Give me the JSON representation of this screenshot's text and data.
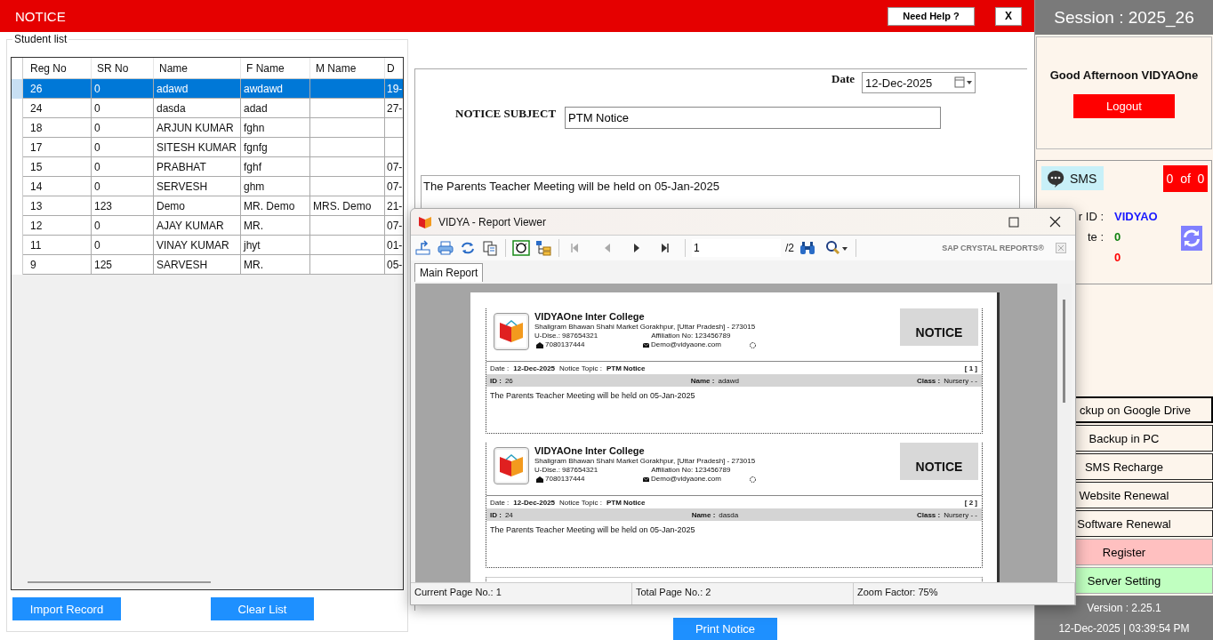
{
  "header": {
    "title": "NOTICE",
    "help_button": "Need Help ?",
    "close_button": "X"
  },
  "student_list": {
    "legend": "Student list",
    "columns": [
      "Reg No",
      "SR No",
      "Name",
      "F Name",
      "M Name",
      "D"
    ],
    "rows": [
      {
        "cells": [
          "26",
          "0",
          "adawd",
          "awdawd",
          null,
          "19-"
        ],
        "selected": true
      },
      {
        "cells": [
          "24",
          "0",
          "dasda",
          "adad",
          null,
          "27-"
        ],
        "selected": false
      },
      {
        "cells": [
          "18",
          "0",
          "ARJUN KUMAR",
          "fghn",
          null,
          null
        ],
        "selected": false
      },
      {
        "cells": [
          "17",
          "0",
          "SITESH KUMAR",
          "fgnfg",
          null,
          null
        ],
        "selected": false
      },
      {
        "cells": [
          "15",
          "0",
          "PRABHAT",
          "fghf",
          null,
          "07-"
        ],
        "selected": false
      },
      {
        "cells": [
          "14",
          "0",
          "SERVESH",
          "ghm",
          null,
          "07-"
        ],
        "selected": false
      },
      {
        "cells": [
          "13",
          "123",
          "Demo",
          "MR. Demo",
          "MRS. Demo",
          "21-"
        ],
        "selected": false
      },
      {
        "cells": [
          "12",
          "0",
          "AJAY KUMAR",
          "MR.",
          null,
          "07-"
        ],
        "selected": false
      },
      {
        "cells": [
          "11",
          "0",
          "VINAY KUMAR",
          "jhyt",
          null,
          "01-"
        ],
        "selected": false
      },
      {
        "cells": [
          "9",
          "125",
          "SARVESH",
          "MR.",
          null,
          "05-"
        ],
        "selected": false
      }
    ],
    "buttons": [
      "Import Record",
      "Clear List"
    ]
  },
  "notice_form": {
    "date_label": "Date",
    "date_value": "12-Dec-2025",
    "subject_label": "NOTICE SUBJECT",
    "subject_value": "PTM Notice",
    "message": "The Parents Teacher Meeting will be held on 05-Jan-2025",
    "print_button": "Print Notice"
  },
  "sidebar": {
    "session": "Session : 2025_26",
    "greeting": "Good Afternoon VIDYAOne",
    "logout": "Logout",
    "sms_label": "SMS",
    "sms_count": "0  of  0",
    "info_rows": [
      {
        "label": "r ID :",
        "value": "VIDYAO",
        "color": "#1a1aff"
      },
      {
        "label": "te :",
        "value": "0",
        "color": "#108010"
      },
      {
        "value": "0",
        "color": "#ff0000"
      }
    ],
    "buttons": [
      {
        "label": "ckup on Google Drive",
        "kind": "focused"
      },
      {
        "label": "Backup in PC",
        "kind": "plain"
      },
      {
        "label": "SMS Recharge",
        "kind": "plain"
      },
      {
        "label": "Website Renewal",
        "kind": "plain"
      },
      {
        "label": "Software Renewal",
        "kind": "plain"
      },
      {
        "label": "Register",
        "kind": "pink"
      },
      {
        "label": "Server Setting",
        "kind": "green"
      }
    ],
    "version": "Version : 2.25.1",
    "datetime": "12-Dec-2025 | 03:39:54 PM"
  },
  "report_viewer": {
    "title": "VIDYA - Report Viewer",
    "page_input": "1",
    "page_total": "/2",
    "brand": "SAP CRYSTAL REPORTS®",
    "tabs": [
      {
        "label": "Main Report",
        "selected": true
      }
    ],
    "records": [
      {
        "school": "VIDYAOne Inter College",
        "address": "Shaligram Bhawan Shahi Market Gorakhpur, [Uttar Pradesh] - 273015",
        "udise": "U-Dise.: 987654321",
        "affiliation": "Affiliation No: 123456789",
        "phone": "7080137444",
        "email": "Demo@vidyaone.com",
        "badge": "NOTICE",
        "date_label": "Date  :",
        "date": "12-Dec-2025",
        "topic_label": "Notice Topic  :",
        "topic": "PTM Notice",
        "index": "[ 1 ]",
        "id_label": "ID  :",
        "id": "26",
        "name_label": "Name  :",
        "name": "adawd",
        "class_label": "Class  :",
        "class": "Nursery - -",
        "message": "The Parents Teacher Meeting will be held on 05-Jan-2025"
      },
      {
        "school": "VIDYAOne Inter College",
        "address": "Shaligram Bhawan Shahi Market Gorakhpur, [Uttar Pradesh] - 273015",
        "udise": "U-Dise.: 987654321",
        "affiliation": "Affiliation No: 123456789",
        "phone": "7080137444",
        "email": "Demo@vidyaone.com",
        "badge": "NOTICE",
        "date_label": "Date  :",
        "date": "12-Dec-2025",
        "topic_label": "Notice Topic  :",
        "topic": "PTM Notice",
        "index": "[ 2 ]",
        "id_label": "ID  :",
        "id": "24",
        "name_label": "Name  :",
        "name": "dasda",
        "class_label": "Class  :",
        "class": "Nursery - -",
        "message": "The Parents Teacher Meeting will be held on 05-Jan-2025"
      }
    ],
    "status": [
      "Current Page No.: 1",
      "Total Page No.: 2",
      "Zoom Factor: 75%"
    ]
  }
}
